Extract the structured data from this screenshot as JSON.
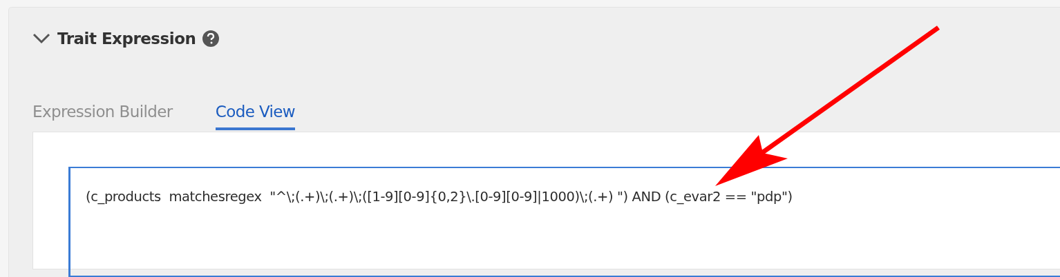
{
  "section": {
    "title": "Trait Expression",
    "expanded": true
  },
  "tabs": [
    {
      "label": "Expression Builder",
      "selected": false
    },
    {
      "label": "Code View",
      "selected": true
    }
  ],
  "code": {
    "value": "(c_products  matchesregex  \"^\\;(.+)\\;(.+)\\;([1-9][0-9]{0,2}\\.[0-9][0-9]|1000)\\;(.+) \") AND (c_evar2 == \"pdp\")"
  }
}
